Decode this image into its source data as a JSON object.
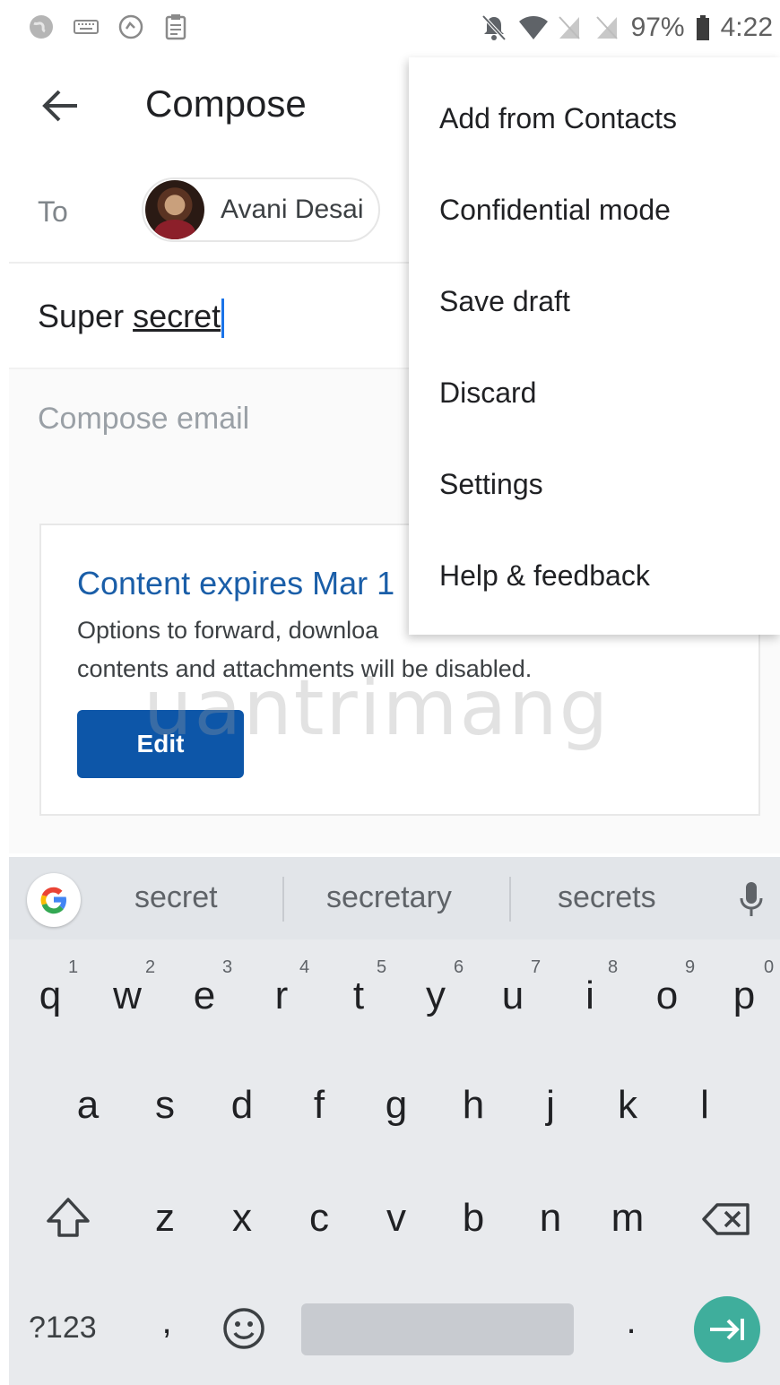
{
  "status_bar": {
    "battery": "97%",
    "time": "4:22"
  },
  "app_bar": {
    "title": "Compose"
  },
  "recipients": {
    "to_label": "To",
    "chip_name": "Avani Desai"
  },
  "subject": {
    "plain": "Super ",
    "underlined": "secret"
  },
  "body": {
    "placeholder": "Compose email"
  },
  "confidential_card": {
    "title": "Content expires Mar 1",
    "text_line1": "Options to forward, downloa",
    "text_line2": "contents and attachments will be disabled.",
    "edit_label": "Edit"
  },
  "watermark": "uantrimang",
  "menu": {
    "items": [
      "Add from Contacts",
      "Confidential mode",
      "Save draft",
      "Discard",
      "Settings",
      "Help & feedback"
    ]
  },
  "keyboard": {
    "suggestions": [
      "secret",
      "secretary",
      "secrets"
    ],
    "row1": [
      "q",
      "w",
      "e",
      "r",
      "t",
      "y",
      "u",
      "i",
      "o",
      "p"
    ],
    "row1_hints": [
      "1",
      "2",
      "3",
      "4",
      "5",
      "6",
      "7",
      "8",
      "9",
      "0"
    ],
    "row2": [
      "a",
      "s",
      "d",
      "f",
      "g",
      "h",
      "j",
      "k",
      "l"
    ],
    "row3": [
      "z",
      "x",
      "c",
      "v",
      "b",
      "n",
      "m"
    ],
    "symbols_label": "?123",
    "comma": ",",
    "period": ".",
    "accent_color": "#3fae9c"
  }
}
